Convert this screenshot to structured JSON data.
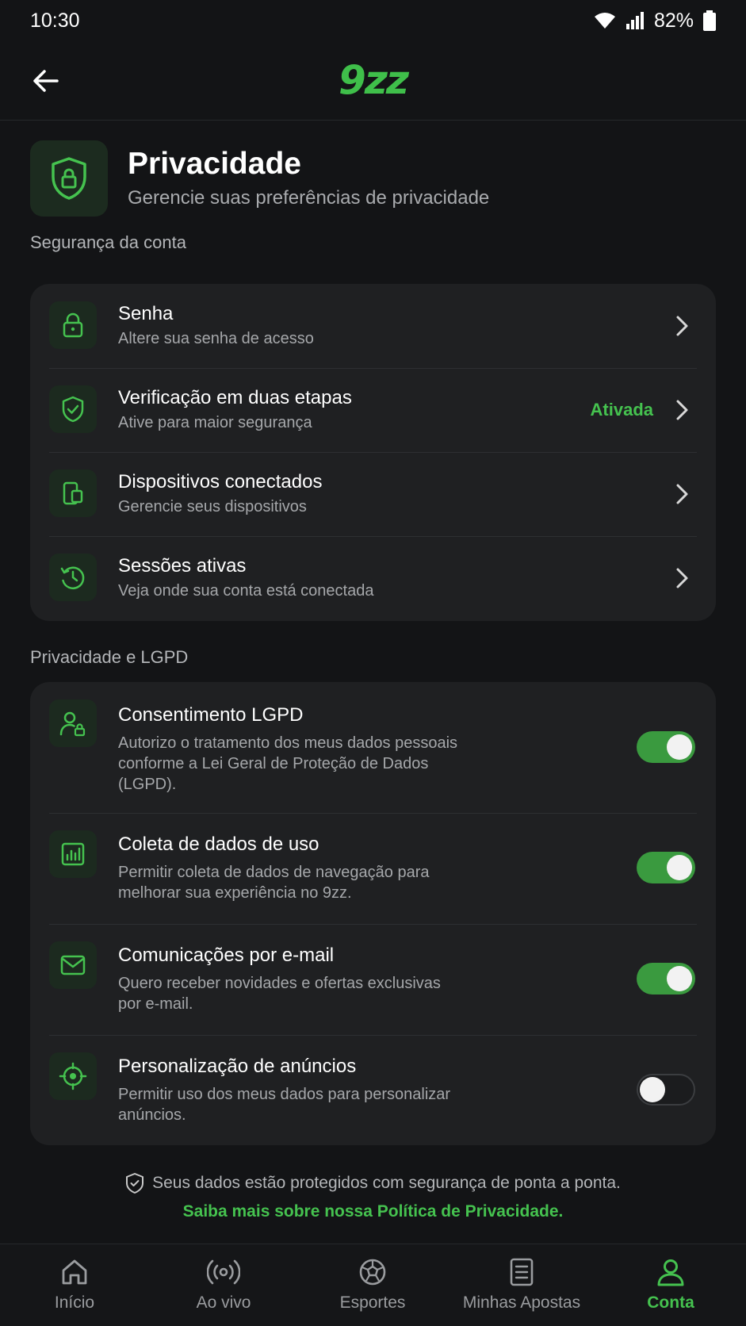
{
  "status_bar": {
    "time": "10:30",
    "battery": "82%",
    "icons": [
      "wifi-icon",
      "signal-icon",
      "battery-icon"
    ]
  },
  "header": {
    "logo": "9zz",
    "back_icon": "arrow-left-icon"
  },
  "hero": {
    "title": "Privacidade",
    "subtitle": "Gerencie suas preferências de privacidade",
    "icon": "shield-lock-icon"
  },
  "sections": {
    "security": {
      "title": "Segurança da conta",
      "items": [
        {
          "title": "Senha",
          "subtitle": "Altere sua senha de acesso",
          "icon": "lock-icon"
        },
        {
          "title": "Verificação em duas etapas",
          "subtitle": "Ative para maior segurança",
          "icon": "shield-check-icon",
          "status": "Ativada"
        },
        {
          "title": "Dispositivos conectados",
          "subtitle": "Gerencie seus dispositivos",
          "icon": "devices-icon"
        },
        {
          "title": "Sessões ativas",
          "subtitle": "Veja onde sua conta está conectada",
          "icon": "history-icon"
        }
      ]
    },
    "privacy": {
      "title": "Privacidade e LGPD",
      "items": [
        {
          "title": "Consentimento LGPD",
          "subtitle": "Autorizo o tratamento dos meus dados pessoais conforme a Lei Geral de Proteção de Dados (LGPD).",
          "icon": "user-lock-icon",
          "enabled": true
        },
        {
          "title": "Coleta de dados de uso",
          "subtitle": "Permitir coleta de dados de navegação para melhorar sua experiência no 9zz.",
          "icon": "bar-chart-icon",
          "enabled": true
        },
        {
          "title": "Comunicações por e-mail",
          "subtitle": "Quero receber novidades e ofertas exclusivas por e-mail.",
          "icon": "mail-icon",
          "enabled": true
        },
        {
          "title": "Personalização de anúncios",
          "subtitle": "Permitir uso dos meus dados para personalizar anúncios.",
          "icon": "target-icon",
          "enabled": false
        }
      ]
    }
  },
  "footer": {
    "note": "Seus dados estão protegidos com segurança de ponta a ponta.",
    "link": "Saiba mais sobre nossa Política de Privacidade."
  },
  "bottom_nav": {
    "items": [
      {
        "label": "Início",
        "icon": "home-icon"
      },
      {
        "label": "Ao vivo",
        "icon": "live-icon"
      },
      {
        "label": "Esportes",
        "icon": "ball-icon"
      },
      {
        "label": "Minhas Apostas",
        "icon": "ticket-icon"
      },
      {
        "label": "Conta",
        "icon": "user-icon",
        "active": true
      }
    ]
  },
  "colors": {
    "accent": "#45c24f",
    "background": "#131416",
    "card": "#1f2022"
  }
}
